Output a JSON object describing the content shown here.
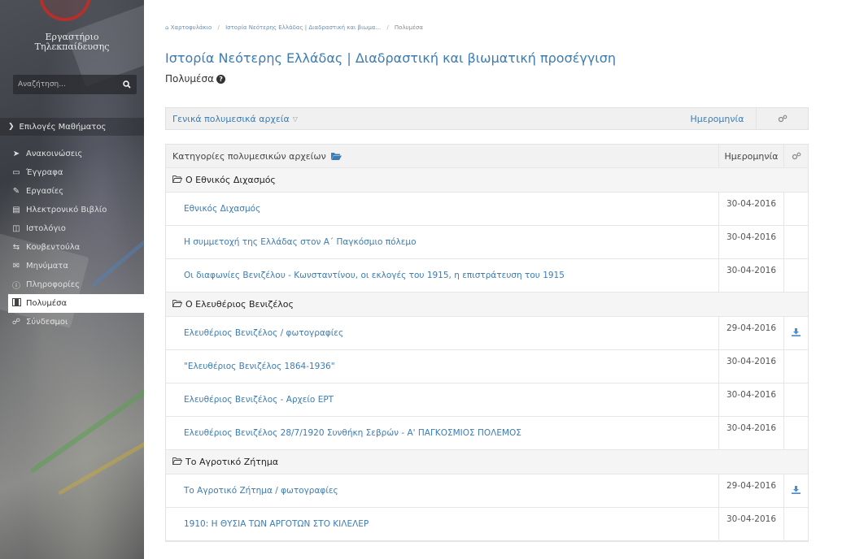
{
  "sidebar": {
    "logo_line1": "Εργαστήριο",
    "logo_line2": "Τηλεκπαίδευσης",
    "search_placeholder": "Αναζήτηση...",
    "section_label": "Επιλογές Μαθήματος",
    "items": [
      {
        "label": "Ανακοινώσεις",
        "icon": "bullhorn-icon",
        "active": false
      },
      {
        "label": "Έγγραφα",
        "icon": "folder-icon",
        "active": false
      },
      {
        "label": "Εργασίες",
        "icon": "pencil-icon",
        "active": false
      },
      {
        "label": "Ηλεκτρονικό Βιβλίο",
        "icon": "book-icon",
        "active": false
      },
      {
        "label": "Ιστολόγιο",
        "icon": "columns-icon",
        "active": false
      },
      {
        "label": "Κουβεντούλα",
        "icon": "exchange-icon",
        "active": false
      },
      {
        "label": "Μηνύματα",
        "icon": "envelope-icon",
        "active": false
      },
      {
        "label": "Πληροφορίες",
        "icon": "info-icon",
        "active": false
      },
      {
        "label": "Πολυμέσα",
        "icon": "film-icon",
        "active": true
      },
      {
        "label": "Σύνδεσμοι",
        "icon": "link-icon",
        "active": false
      }
    ]
  },
  "breadcrumb": {
    "home": "Χαρτοφυλάκιο",
    "course": "Ιστορία Νεότερης Ελλάδας | Διαδραστική και βιωμα...",
    "current": "Πολυμέσα"
  },
  "page": {
    "title": "Ιστορία Νεότερης Ελλάδας | Διαδραστική και βιωματική προσέγγιση",
    "subtitle": "Πολυμέσα"
  },
  "general_box": {
    "title": "Γενικά πολυμεσικά αρχεία",
    "date_label": "Ημερομηνία"
  },
  "table": {
    "header_name": "Κατηγορίες πολυμεσικών αρχείων",
    "header_date": "Ημερομηνία",
    "rows": [
      {
        "type": "category",
        "name": "Ο Εθνικός Διχασμός"
      },
      {
        "type": "item",
        "name": "Εθνικός Διχασμός",
        "date": "30-04-2016",
        "download": false
      },
      {
        "type": "item",
        "name": "Η συμμετοχή της Ελλάδας στον Α΄ Παγκόσμιο πόλεμο",
        "date": "30-04-2016",
        "download": false
      },
      {
        "type": "item",
        "name": "Οι διαφωνίες Βενιζέλου - Κωνσταντίνου, οι εκλογές του 1915, η επιστράτευση του 1915",
        "date": "30-04-2016",
        "download": false
      },
      {
        "type": "category",
        "name": "Ο Ελευθέριος Βενιζέλος"
      },
      {
        "type": "item",
        "name": "Ελευθέριος Βενιζέλος / φωτογραφίες",
        "date": "29-04-2016",
        "download": true
      },
      {
        "type": "item",
        "name": "\"Ελευθέριος Βενιζέλος 1864-1936\"",
        "date": "30-04-2016",
        "download": false
      },
      {
        "type": "item",
        "name": "Ελευθέριος Βενιζέλος - Αρχείο ΕΡΤ",
        "date": "30-04-2016",
        "download": false
      },
      {
        "type": "item",
        "name": "Ελευθέριος Βενιζέλος 28/7/1920 Συνθήκη Σεβρών - Α' ΠΑΓΚΟΣΜΙΟΣ ΠΟΛΕΜΟΣ",
        "date": "30-04-2016",
        "download": false
      },
      {
        "type": "category",
        "name": "Το Αγροτικό Ζήτημα"
      },
      {
        "type": "item",
        "name": "Το Αγροτικό Ζήτημα / φωτογραφίες",
        "date": "29-04-2016",
        "download": true
      },
      {
        "type": "item",
        "name": "1910: Η ΘΥΣΙΑ ΤΩΝ ΑΡΓΟΤΩΝ ΣΤΟ ΚΙΛΕΛΕΡ",
        "date": "30-04-2016",
        "download": false
      }
    ]
  },
  "colors": {
    "link": "#3b7cb5",
    "logo_red": "#b2312c",
    "download": "#4a90d0"
  }
}
